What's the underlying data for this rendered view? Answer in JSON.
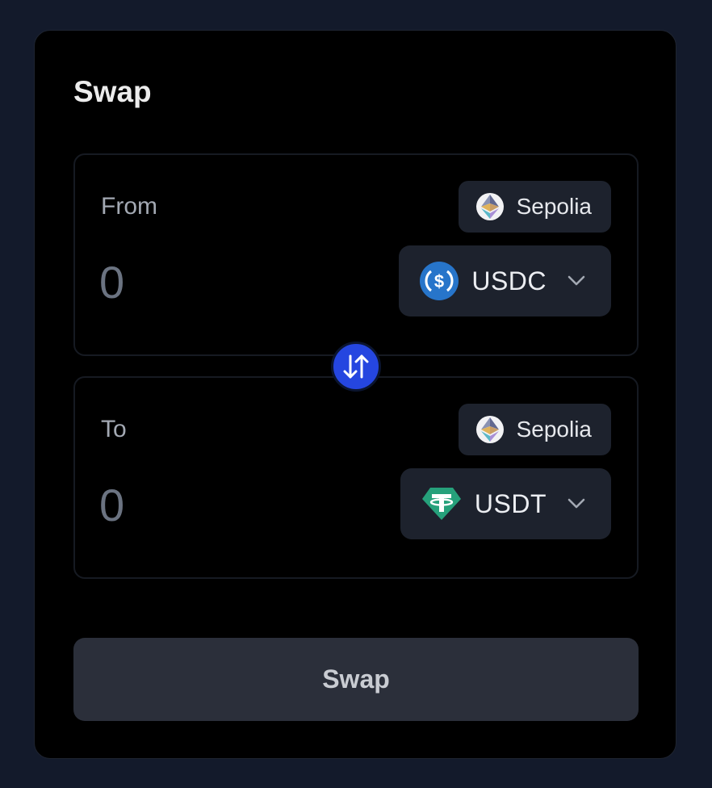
{
  "card": {
    "title": "Swap"
  },
  "from": {
    "label": "From",
    "amount_placeholder": "0",
    "network": {
      "label": "Sepolia",
      "icon": "ethereum-icon"
    },
    "token": {
      "label": "USDC",
      "icon": "usdc-icon",
      "color": "#2775ca"
    }
  },
  "to": {
    "label": "To",
    "amount_placeholder": "0",
    "network": {
      "label": "Sepolia",
      "icon": "ethereum-icon"
    },
    "token": {
      "label": "USDT",
      "icon": "usdt-icon",
      "color": "#26a17b"
    }
  },
  "switch": {
    "icon": "swap-arrows-icon",
    "color": "#2546e0"
  },
  "action": {
    "label": "Swap"
  }
}
